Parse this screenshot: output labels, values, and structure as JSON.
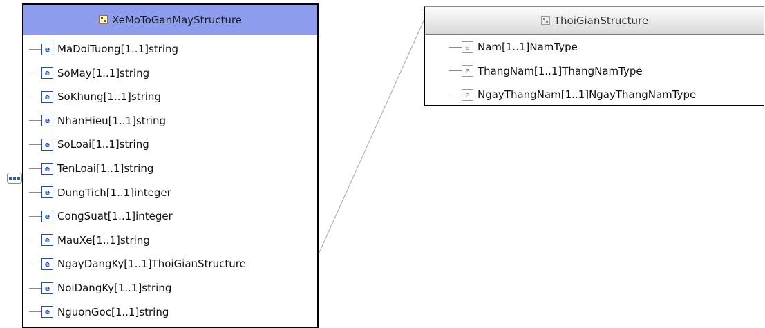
{
  "left_structure": {
    "title": "XeMoToGanMayStructure",
    "elements": [
      {
        "name": "MaDoiTuong",
        "cardinality": "[1..1]",
        "type": "string"
      },
      {
        "name": "SoMay",
        "cardinality": "[1..1]",
        "type": "string"
      },
      {
        "name": "SoKhung",
        "cardinality": "[1..1]",
        "type": "string"
      },
      {
        "name": "NhanHieu",
        "cardinality": "[1..1]",
        "type": "string"
      },
      {
        "name": "SoLoai",
        "cardinality": "[1..1]",
        "type": "string"
      },
      {
        "name": "TenLoai",
        "cardinality": "[1..1]",
        "type": "string"
      },
      {
        "name": "DungTich",
        "cardinality": "[1..1]",
        "type": "integer"
      },
      {
        "name": "CongSuat",
        "cardinality": "[1..1]",
        "type": "integer"
      },
      {
        "name": "MauXe",
        "cardinality": "[1..1]",
        "type": "string"
      },
      {
        "name": "NgayDangKy",
        "cardinality": "[1..1]",
        "type": "ThoiGianStructure"
      },
      {
        "name": "NoiDangKy",
        "cardinality": "[1..1]",
        "type": "string"
      },
      {
        "name": "NguonGoc",
        "cardinality": "[1..1]",
        "type": "string"
      }
    ]
  },
  "right_structure": {
    "title": "ThoiGianStructure",
    "elements": [
      {
        "name": "Nam",
        "cardinality": "[1..1]",
        "type": "NamType"
      },
      {
        "name": "ThangNam",
        "cardinality": "[1..1]",
        "type": "ThangNamType"
      },
      {
        "name": "NgayThangNam",
        "cardinality": "[1..1]",
        "type": "NgayThangNamType"
      }
    ]
  },
  "element_badge": "e",
  "colors": {
    "left_header": "#8d9cec",
    "element_badge": "#1f4fbf",
    "inactive_badge": "#999999",
    "connector": "#8a8a8a"
  },
  "icons": {
    "left_header": "complex-type-icon",
    "right_header": "complex-type-icon",
    "left_compositor": "sequence-icon",
    "right_compositor": "choice-icon"
  }
}
